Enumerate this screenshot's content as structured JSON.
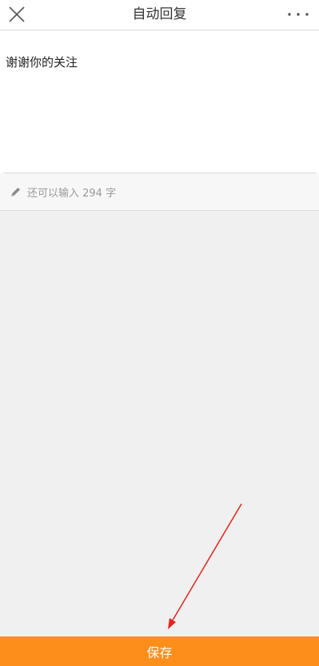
{
  "header": {
    "title": "自动回复",
    "close_icon": "close-icon",
    "more_icon": "more-horizontal-icon"
  },
  "editor": {
    "value": "谢谢你的关注"
  },
  "counter": {
    "icon": "pencil-icon",
    "text": "还可以输入 294 字"
  },
  "footer": {
    "save_label": "保存"
  },
  "colors": {
    "accent": "#fd8e1a",
    "annotation": "#e8231a",
    "background": "#f0f0f0"
  }
}
